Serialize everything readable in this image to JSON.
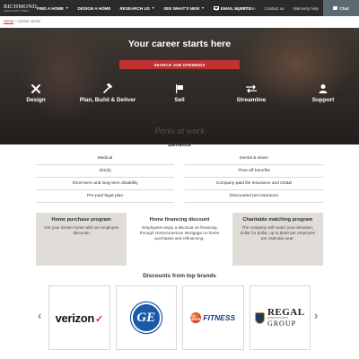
{
  "logo": {
    "main": "RICHMOND",
    "sub": "AMERICAN HOMES"
  },
  "nav": {
    "items": [
      {
        "label": "FIND A HOME",
        "has_caret": true
      },
      {
        "label": "DESIGN A HOME",
        "has_caret": false
      },
      {
        "label": "RESEARCH US",
        "has_caret": true
      },
      {
        "label": "SEE WHAT'S NEW",
        "has_caret": true
      },
      {
        "label": "EMAIL ALERTS",
        "icon": "envelope-icon"
      }
    ],
    "utility": [
      "Sign in/Join",
      "Contact us",
      "Warranty help"
    ],
    "chat_label": "Chat"
  },
  "breadcrumb": {
    "home": "Home",
    "separator": "»",
    "current": "Career center"
  },
  "hero": {
    "title": "Your career starts here",
    "button": "SEARCH JOB OPENINGS",
    "features": [
      {
        "label": "Design",
        "icon": "pencil-cross-icon"
      },
      {
        "label": "Plan, Build & Deliver",
        "icon": "hammer-icon"
      },
      {
        "label": "Sell",
        "icon": "sign-icon"
      },
      {
        "label": "Streamline",
        "icon": "arrows-icon"
      },
      {
        "label": "Support",
        "icon": "person-icon"
      }
    ]
  },
  "perks": {
    "title": "Perks at work",
    "benefits_title": "Benefits",
    "benefits": [
      [
        "Medical",
        "Dental & vision"
      ],
      [
        "401(k)",
        "Time-off benefits"
      ],
      [
        "Short-term and long-term disability",
        "Company-paid life insurance and AD&D"
      ],
      [
        "Pre-paid legal plan",
        "Discounted pet insurance"
      ]
    ]
  },
  "programs": [
    {
      "title": "Home purchase program",
      "body": "Get your dream home with our employee discount!"
    },
    {
      "title": "Home financing discount",
      "body": "Employees enjoy a discount on financing through HomeAmerican Mortgage on home purchases and refinancing."
    },
    {
      "title": "Charitable matching program",
      "body": "The company will match your donation, dollar for dollar, up to $100 per employee per calendar year."
    }
  ],
  "brands": {
    "title": "Discounts from top brands",
    "verizon": {
      "word": "verizon",
      "mark": "✓"
    },
    "ge": {
      "word": "GE"
    },
    "fitness": {
      "badge": "24 HOUR",
      "word": "FITNESS"
    },
    "regal": {
      "main": "REGAL",
      "mid": "ENTERTAINMENT",
      "group": "GROUP"
    },
    "prev_arrow": "‹",
    "next_arrow": "›"
  }
}
